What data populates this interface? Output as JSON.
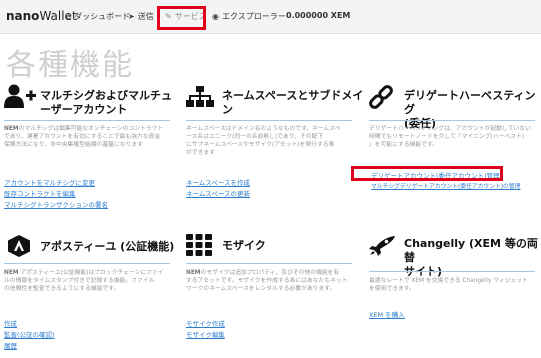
{
  "navbar": {
    "brand_bold": "nano",
    "brand_light": "Wallet",
    "items": [
      {
        "label": "ダッシュボード"
      },
      {
        "label": "送信"
      },
      {
        "label": "サービス"
      },
      {
        "label": "エクスプローラー"
      }
    ],
    "balance": "0.000000 XEM"
  },
  "page_title": "各種機能",
  "cards": [
    {
      "title_lines": [
        "マルチシグおよびマルチュ",
        "ーザーアカウント"
      ],
      "desc_lead": "NEM",
      "desc_lines": [
        "のマルチシグは編集可能なオンチェーンのコントラクト",
        "であり、連署アカウントを有効にすることで最も強力な資金",
        "保護方法になり、非中央集権型組織の基盤になります"
      ],
      "links": [
        "アカウントをマルチシグに変更",
        "既存コントラクトを編集",
        "マルチシグトランザクションの署名"
      ]
    },
    {
      "title_lines": [
        "ネームスペースとサブドメイ",
        "ン"
      ],
      "desc_lead": "",
      "desc_lines": [
        "ネームスペースはドメイン名のようなものです。ネームスペ",
        "ース名はユニーク(同一の名前無し)であり、その配下",
        "にサブネームスペースやモザイク(アセット)を発行する事",
        "ができます"
      ],
      "links": [
        "ネームスペースを作成",
        "ネームスペースの更新"
      ]
    },
    {
      "title_lines": [
        "デリゲートハーベスティング",
        "(委任)"
      ],
      "desc_lead": "",
      "desc_lines": [
        "デリゲートハーベスティングは、アカウントが起動していない",
        "時間でもリモートノードを介して「マイニング(ハーベスト)",
        "」を可能にする機能です。"
      ],
      "links": [
        "デリゲートアカウント(委任アカウント)管理",
        "マルチシグデリゲートアカウント(委任アカウント)の管理"
      ]
    },
    {
      "title_lines": [
        "アポスティーユ (公証機能)"
      ],
      "desc_lead": "NEM",
      "desc_lines": [
        " アポスティーユ(公証機能)はブロックチェーンにファイ",
        "ルの情報をタイムスタンプ付きで記録する機能。ファイル",
        "の信頼性を監査できるようにする機能です。"
      ],
      "links": [
        "作成",
        "監査(公証の確認)",
        "履歴"
      ]
    },
    {
      "title_lines": [
        "モザイク"
      ],
      "desc_lead": "NEM",
      "desc_lines": [
        "のモザイクは追加プロパティ、及びその他の機能を有",
        "するアセットです。モザイクを作成する為にはあなたもネット",
        "ワークのネームスペースをレンタルする必要があります。"
      ],
      "links": [
        "モザイク作成",
        "モザイク編集"
      ]
    },
    {
      "title_lines": [
        "Changelly (XEM 等の両替",
        "サイト)"
      ],
      "desc_lead": "",
      "desc_lines": [
        "最適なレートで XEM を交換できる Changelly ウィジェット",
        "を使用できます。"
      ],
      "links": [
        "XEM を購入"
      ]
    }
  ]
}
